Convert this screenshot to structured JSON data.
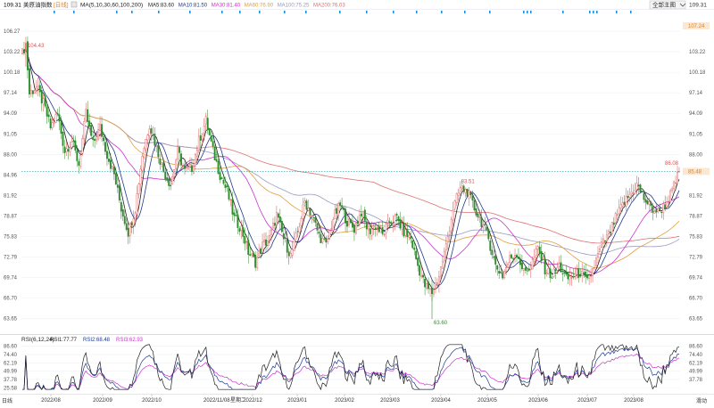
{
  "header": {
    "title": "美原油指数",
    "period": "[日线]",
    "ma_label": "MA(5,10,30,60,100,200)",
    "ma_values": [
      {
        "text": "MA5:83.60",
        "color": "#1f1f1f"
      },
      {
        "text": "MA10:81.50",
        "color": "#1f3a93"
      },
      {
        "text": "MA30:81.40",
        "color": "#cc33cc"
      },
      {
        "text": "MA60:76.90",
        "color": "#e0a040"
      },
      {
        "text": "MA100:75.25",
        "color": "#9a9ac0"
      },
      {
        "text": "MA200:76.03",
        "color": "#e07070"
      }
    ],
    "top_axis_value": "109.31",
    "top_axis_value_right": "109.31",
    "dropdown_label": "全部主图"
  },
  "rsi_header": {
    "label": "RSI(6,12,24)",
    "values": [
      {
        "text": "RSI1:77.77",
        "color": "#1f1f1f"
      },
      {
        "text": "RSI2:68.48",
        "color": "#1f3a93"
      },
      {
        "text": "RSI3:62.93",
        "color": "#cc33cc"
      }
    ]
  },
  "annotations": {
    "high_label": "104.43",
    "apr_peak_label": "83.51",
    "low_label": "63.60",
    "last_label": "86.08",
    "current_price_tag": "85.48",
    "ma_tag": "107.24",
    "bottom_left": "日线",
    "bottom_right": "滑动",
    "center_date": "2022/11/08",
    "center_weekday": "星期二"
  },
  "colors": {
    "up": "#e05050",
    "down": "#2e8b2e",
    "ma5": "#1f1f1f",
    "ma10": "#1f3a93",
    "ma30": "#cc33cc",
    "ma60": "#e0a040",
    "ma100": "#9a9ac0",
    "ma200": "#e07070",
    "price_line": "#20a0a0",
    "marker": "#1e8fd8"
  },
  "chart_data": [
    {
      "type": "candlestick",
      "title": "美原油指数 [日线]",
      "y_ticks": [
        "106.27",
        "103.22",
        "100.18",
        "97.14",
        "94.09",
        "91.05",
        "88.00",
        "84.96",
        "81.92",
        "78.87",
        "75.83",
        "72.79",
        "69.74",
        "66.70",
        "63.65"
      ],
      "y_ticks_right": [
        "103.22",
        "100.18",
        "97.14",
        "94.09",
        "91.05",
        "88.00",
        "81.92",
        "78.87",
        "75.83",
        "72.79",
        "69.74",
        "66.70",
        "63.65"
      ],
      "ylim": [
        61.5,
        109.31
      ],
      "x_ticks": [
        "2022/08",
        "2022/09",
        "2022/10",
        "2022/11",
        "2022/12",
        "2023/01",
        "2023/02",
        "2023/03",
        "2023/04",
        "2023/05",
        "2023/06",
        "2023/07",
        "2023/08"
      ],
      "close_anchors": [
        [
          0,
          103.0
        ],
        [
          2,
          104.43
        ],
        [
          4,
          97.0
        ],
        [
          8,
          98.0
        ],
        [
          12,
          95.5
        ],
        [
          16,
          92.0
        ],
        [
          20,
          94.0
        ],
        [
          24,
          88.5
        ],
        [
          28,
          90.0
        ],
        [
          32,
          86.5
        ],
        [
          36,
          94.0
        ],
        [
          40,
          89.5
        ],
        [
          44,
          92.0
        ],
        [
          48,
          88.0
        ],
        [
          52,
          85.0
        ],
        [
          56,
          80.0
        ],
        [
          60,
          76.5
        ],
        [
          64,
          80.0
        ],
        [
          68,
          88.0
        ],
        [
          72,
          92.5
        ],
        [
          76,
          89.0
        ],
        [
          80,
          85.5
        ],
        [
          84,
          83.5
        ],
        [
          88,
          88.5
        ],
        [
          92,
          85.5
        ],
        [
          96,
          86.0
        ],
        [
          100,
          90.0
        ],
        [
          104,
          93.0
        ],
        [
          108,
          88.5
        ],
        [
          112,
          85.0
        ],
        [
          116,
          82.5
        ],
        [
          120,
          78.5
        ],
        [
          124,
          77.0
        ],
        [
          128,
          73.5
        ],
        [
          132,
          72.0
        ],
        [
          136,
          74.5
        ],
        [
          140,
          75.5
        ],
        [
          144,
          79.0
        ],
        [
          148,
          75.5
        ],
        [
          152,
          73.0
        ],
        [
          156,
          76.5
        ],
        [
          160,
          81.0
        ],
        [
          164,
          79.0
        ],
        [
          168,
          76.0
        ],
        [
          172,
          74.5
        ],
        [
          176,
          78.5
        ],
        [
          180,
          80.5
        ],
        [
          184,
          78.0
        ],
        [
          188,
          77.0
        ],
        [
          192,
          79.5
        ],
        [
          196,
          76.5
        ],
        [
          200,
          77.5
        ],
        [
          204,
          76.0
        ],
        [
          208,
          78.0
        ],
        [
          212,
          78.5
        ],
        [
          216,
          76.5
        ],
        [
          220,
          75.5
        ],
        [
          224,
          71.5
        ],
        [
          228,
          68.5
        ],
        [
          232,
          67.5
        ],
        [
          236,
          70.0
        ],
        [
          240,
          74.5
        ],
        [
          244,
          80.0
        ],
        [
          248,
          83.0
        ],
        [
          252,
          82.5
        ],
        [
          256,
          80.0
        ],
        [
          260,
          78.0
        ],
        [
          264,
          75.5
        ],
        [
          268,
          71.5
        ],
        [
          272,
          70.0
        ],
        [
          276,
          72.5
        ],
        [
          280,
          73.5
        ],
        [
          284,
          70.5
        ],
        [
          288,
          71.5
        ],
        [
          292,
          74.0
        ],
        [
          296,
          71.0
        ],
        [
          300,
          70.0
        ],
        [
          304,
          71.5
        ],
        [
          308,
          69.5
        ],
        [
          312,
          70.0
        ],
        [
          316,
          70.5
        ],
        [
          320,
          69.0
        ],
        [
          324,
          71.5
        ],
        [
          328,
          74.5
        ],
        [
          332,
          76.0
        ],
        [
          336,
          78.5
        ],
        [
          340,
          80.5
        ],
        [
          344,
          82.0
        ],
        [
          348,
          83.5
        ],
        [
          352,
          81.5
        ],
        [
          356,
          80.0
        ],
        [
          360,
          79.5
        ],
        [
          364,
          80.5
        ],
        [
          368,
          82.5
        ],
        [
          372,
          85.5
        ]
      ],
      "candle_count": 373,
      "highlights": {
        "high": 104.43,
        "low": 63.6,
        "apr_peak": 83.51,
        "last": 86.08,
        "current": 85.48
      },
      "series": [
        {
          "name": "MA5",
          "value": 83.6
        },
        {
          "name": "MA10",
          "value": 81.5
        },
        {
          "name": "MA30",
          "value": 81.4
        },
        {
          "name": "MA60",
          "value": 76.9
        },
        {
          "name": "MA100",
          "value": 75.25
        },
        {
          "name": "MA200",
          "value": 76.03
        }
      ]
    },
    {
      "type": "line",
      "title": "RSI(6,12,24)",
      "y_ticks": [
        "86.60",
        "74.40",
        "62.19",
        "49.99",
        "37.78",
        "25.58"
      ],
      "y_ticks_right": [
        "86.60",
        "74.40",
        "62.19",
        "49.99",
        "37.78"
      ],
      "ylim": [
        22,
        90
      ],
      "series": [
        {
          "name": "RSI1",
          "value": 77.77
        },
        {
          "name": "RSI2",
          "value": 68.48
        },
        {
          "name": "RSI3",
          "value": 62.93
        }
      ]
    }
  ]
}
